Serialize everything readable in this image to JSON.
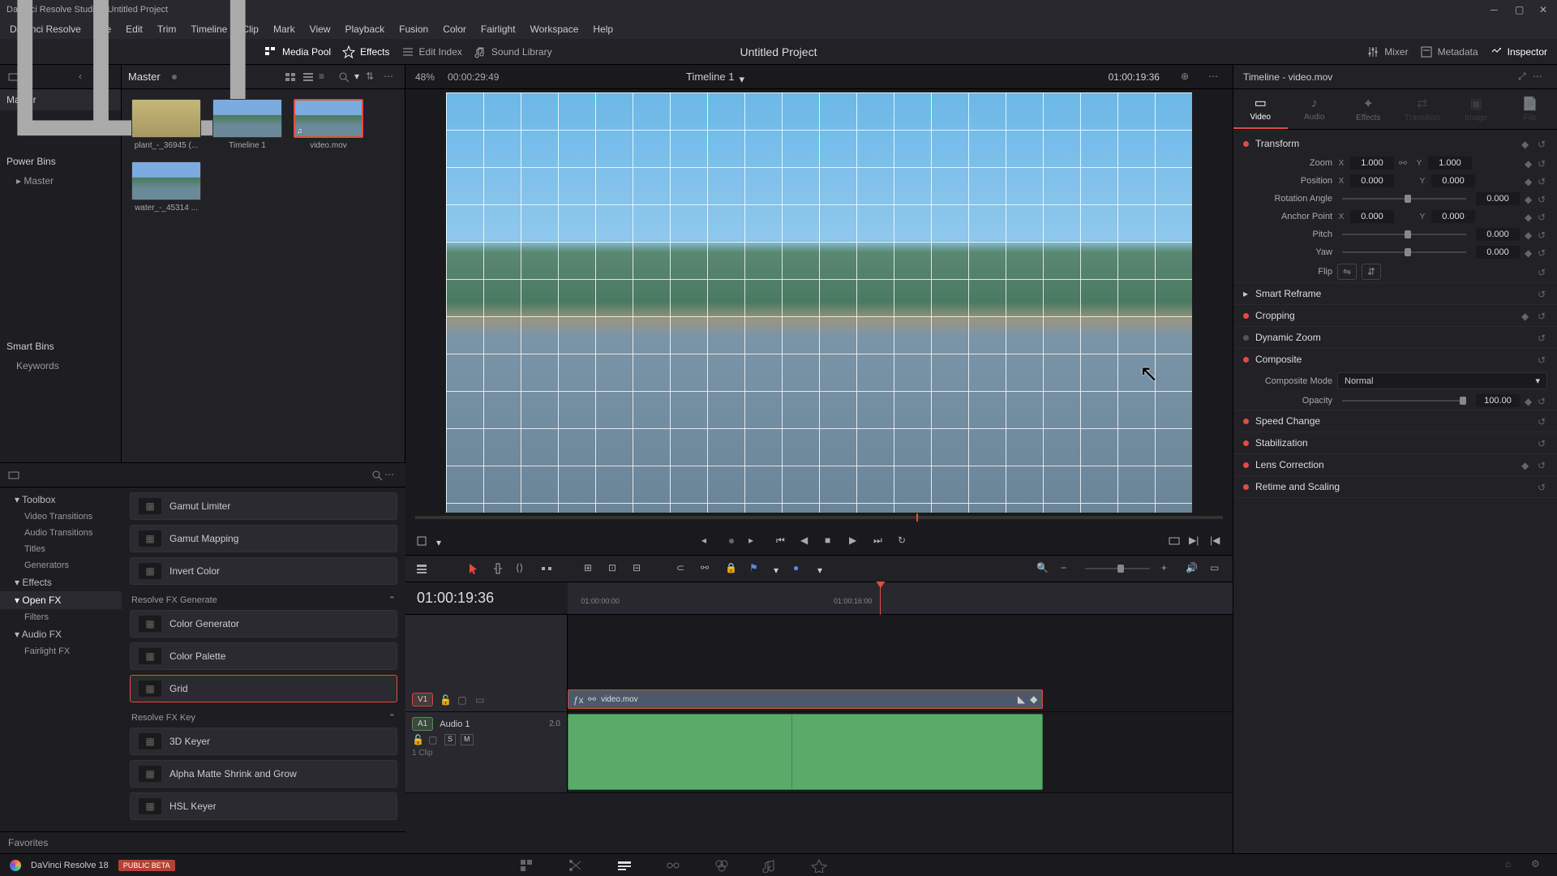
{
  "titlebar": {
    "title": "DaVinci Resolve Studio - Untitled Project"
  },
  "menubar": [
    "DaVinci Resolve",
    "File",
    "Edit",
    "Trim",
    "Timeline",
    "Clip",
    "Mark",
    "View",
    "Playback",
    "Fusion",
    "Color",
    "Fairlight",
    "Workspace",
    "Help"
  ],
  "top_tools_left": [
    {
      "label": "Media Pool"
    },
    {
      "label": "Effects"
    },
    {
      "label": "Edit Index"
    },
    {
      "label": "Sound Library"
    }
  ],
  "top_tools_right": [
    {
      "label": "Mixer"
    },
    {
      "label": "Metadata"
    },
    {
      "label": "Inspector"
    }
  ],
  "project_title": "Untitled Project",
  "media_pool": {
    "master": "Master",
    "power_bins": "Power Bins",
    "power_bins_items": [
      "Master"
    ],
    "smart_bins": "Smart Bins",
    "smart_bins_items": [
      "Keywords"
    ],
    "favorites": "Favorites",
    "thumbs": [
      {
        "label": "plant_-_36945 (..."
      },
      {
        "label": "Timeline 1"
      },
      {
        "label": "video.mov",
        "selected": true
      },
      {
        "label": "water_-_45314 ..."
      }
    ]
  },
  "fx": {
    "tree": [
      {
        "label": "Toolbox",
        "expand": true
      },
      {
        "label": "Video Transitions",
        "sub": true
      },
      {
        "label": "Audio Transitions",
        "sub": true
      },
      {
        "label": "Titles",
        "sub": true
      },
      {
        "label": "Generators",
        "sub": true
      },
      {
        "label": "Effects",
        "expand": true
      },
      {
        "label": "Open FX",
        "expand": true,
        "selected": true
      },
      {
        "label": "Filters",
        "sub": true
      },
      {
        "label": "Audio FX",
        "expand": true
      },
      {
        "label": "Fairlight FX",
        "sub": true
      }
    ],
    "groups": [
      {
        "title": "",
        "items": [
          {
            "label": "Gamut Limiter"
          },
          {
            "label": "Gamut Mapping"
          },
          {
            "label": "Invert Color"
          }
        ]
      },
      {
        "title": "Resolve FX Generate",
        "items": [
          {
            "label": "Color Generator"
          },
          {
            "label": "Color Palette"
          },
          {
            "label": "Grid",
            "selected": true
          }
        ]
      },
      {
        "title": "Resolve FX Key",
        "items": [
          {
            "label": "3D Keyer"
          },
          {
            "label": "Alpha Matte Shrink and Grow"
          },
          {
            "label": "HSL Keyer"
          }
        ]
      }
    ]
  },
  "viewer": {
    "zoom": "48%",
    "left_tc": "00:00:29:49",
    "timeline_name": "Timeline 1",
    "right_tc": "01:00:19:36"
  },
  "timeline": {
    "tc": "01:00:19:36",
    "ticks": [
      "01:00:00:00",
      "01:00:16:00"
    ],
    "v1": "V1",
    "a1": "A1",
    "audio_name": "Audio 1",
    "audio_db": "2.0",
    "clip_count": "1 Clip",
    "video_clip": "video.mov"
  },
  "inspector": {
    "header": "Timeline - video.mov",
    "tabs": [
      "Video",
      "Audio",
      "Effects",
      "Transition",
      "Image",
      "File"
    ],
    "transform": {
      "title": "Transform",
      "zoom_label": "Zoom",
      "zoom_x": "1.000",
      "zoom_y": "1.000",
      "pos_label": "Position",
      "pos_x": "0.000",
      "pos_y": "0.000",
      "rot_label": "Rotation Angle",
      "rot": "0.000",
      "anchor_label": "Anchor Point",
      "anchor_x": "0.000",
      "anchor_y": "0.000",
      "pitch_label": "Pitch",
      "pitch": "0.000",
      "yaw_label": "Yaw",
      "yaw": "0.000",
      "flip_label": "Flip"
    },
    "smart_reframe": "Smart Reframe",
    "cropping": "Cropping",
    "dynamic_zoom": "Dynamic Zoom",
    "composite": {
      "title": "Composite",
      "mode_label": "Composite Mode",
      "mode": "Normal",
      "opacity_label": "Opacity",
      "opacity": "100.00"
    },
    "speed_change": "Speed Change",
    "stabilization": "Stabilization",
    "lens_correction": "Lens Correction",
    "retime": "Retime and Scaling"
  },
  "footer": {
    "app": "DaVinci Resolve 18",
    "badge": "PUBLIC BETA"
  }
}
